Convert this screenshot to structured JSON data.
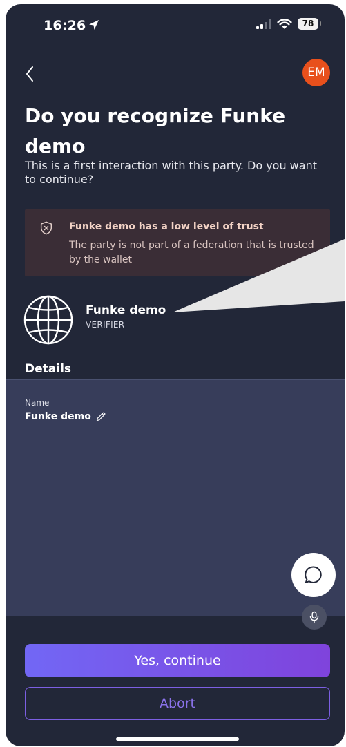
{
  "status_bar": {
    "time": "16:26",
    "battery": "78"
  },
  "header": {
    "avatar_initials": "EM"
  },
  "main": {
    "title": "Do you recognize Funke demo",
    "subtitle": "This is a first interaction with this party. Do you want to continue?",
    "warning": {
      "title": "Funke demo has a low level of trust",
      "text": "The party is not part of a federation that is trusted by the wallet"
    },
    "party": {
      "name": "Funke demo",
      "role": "VERIFIER"
    },
    "details_heading": "Details",
    "details": {
      "name_label": "Name",
      "name_value": "Funke demo"
    }
  },
  "actions": {
    "continue_label": "Yes, continue",
    "abort_label": "Abort"
  },
  "colors": {
    "background": "#222738",
    "card": "#373d5a",
    "warning_bg": "#3a2d36",
    "avatar": "#e8501c",
    "accent": "#7c5fe2"
  }
}
